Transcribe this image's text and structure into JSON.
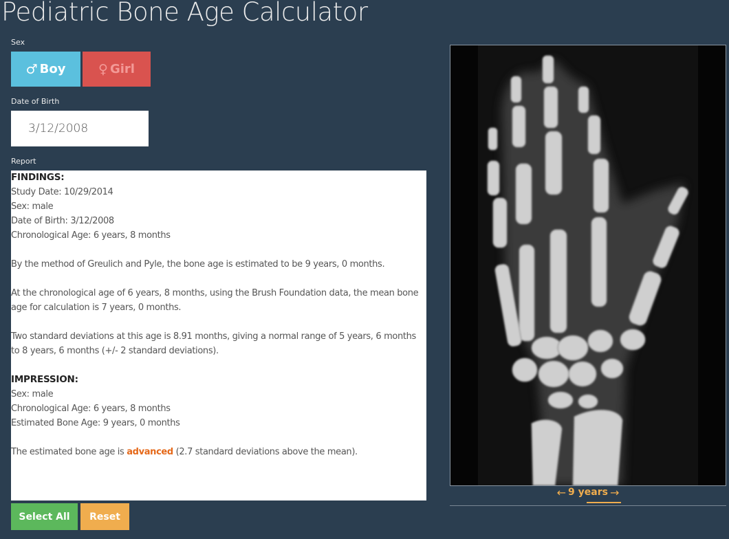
{
  "app": {
    "title": "Pediatric Bone Age Calculator"
  },
  "sex": {
    "label": "Sex",
    "boy_glyph": "♂",
    "boy_label": "Boy",
    "girl_glyph": "♀",
    "girl_label": "Girl",
    "selected": "Boy"
  },
  "dob": {
    "label": "Date of Birth",
    "value": "3/12/2008"
  },
  "report": {
    "label": "Report",
    "findings_heading": "FINDINGS:",
    "study_date": "Study Date: 10/29/2014",
    "sex": "Sex: male",
    "dob": "Date of Birth: 3/12/2008",
    "chrono_age": "Chronological Age: 6 years, 8 months",
    "method": "By the method of Greulich and Pyle, the bone age is estimated to be 9 years, 0 months.",
    "brush_line1": "At the chronological age of 6 years, 8 months, using the Brush Foundation data, the mean bone",
    "brush_line2": "age for calculation is 7 years, 0 months.",
    "sd_line1": "Two standard deviations at this age is 8.91 months, giving a normal range of 5 years, 6 months",
    "sd_line2": "to 8 years, 6 months (+/- 2 standard deviations).",
    "impression_heading": "IMPRESSION:",
    "imp_sex": "Sex: male",
    "imp_chrono": "Chronological Age: 6 years, 8 months",
    "imp_bone_age": "Estimated Bone Age: 9 years, 0 months",
    "conclusion_pre": "The estimated bone age is ",
    "conclusion_word": "advanced",
    "conclusion_post": " (2.7 standard deviations above the mean)."
  },
  "actions": {
    "select_all": "Select All",
    "reset": "Reset"
  },
  "atlas": {
    "prev_arrow": "←",
    "label": "9 years",
    "next_arrow": "→"
  },
  "colors": {
    "background": "#2b3e50",
    "boy": "#5bc0de",
    "girl": "#d9534f",
    "select_all": "#5cb85c",
    "reset": "#f0ad4e",
    "highlight": "#e5691a",
    "nav": "#f0ad4e"
  }
}
